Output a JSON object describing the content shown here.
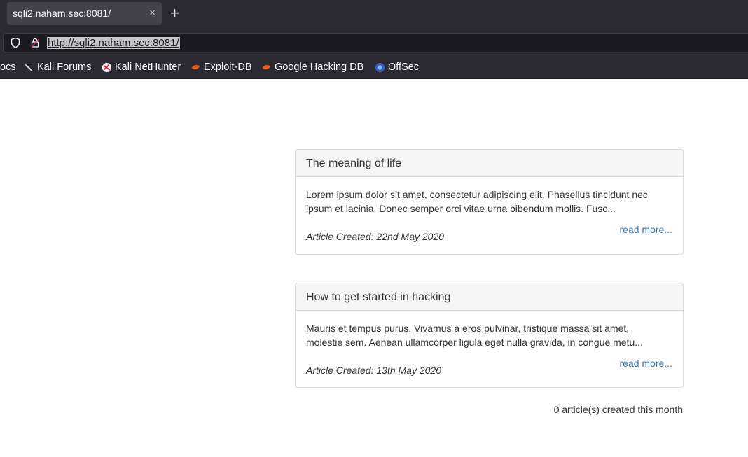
{
  "browser": {
    "tab_title": "sqli2.naham.sec:8081/",
    "tab_close": "×",
    "new_tab": "+",
    "url": "http://sqli2.naham.sec:8081/",
    "bookmarks": [
      {
        "label": "ocs",
        "icon": "none"
      },
      {
        "label": "Kali Forums",
        "icon": "kali-dragon-icon"
      },
      {
        "label": "Kali NetHunter",
        "icon": "nethunter-icon"
      },
      {
        "label": "Exploit-DB",
        "icon": "exploit-db-icon"
      },
      {
        "label": "Google Hacking DB",
        "icon": "ghdb-icon"
      },
      {
        "label": "OffSec",
        "icon": "offsec-icon"
      }
    ]
  },
  "articles": [
    {
      "title": "The meaning of life",
      "excerpt": "Lorem ipsum dolor sit amet, consectetur adipiscing elit. Phasellus tincidunt nec ipsum et lacinia. Donec semper orci vitae urna bibendum mollis. Fusc...",
      "read_more": "read more...",
      "created": "Article Created: 22nd May 2020"
    },
    {
      "title": "How to get started in hacking",
      "excerpt": "Mauris et tempus purus. Vivamus a eros pulvinar, tristique massa sit amet, molestie sem. Aenean ullamcorper ligula eget nulla gravida, in congue metu...",
      "read_more": "read more...",
      "created": "Article Created: 13th May 2020"
    }
  ],
  "footer": {
    "count_text": "0 article(s) created this month"
  },
  "colors": {
    "chrome_bg": "#2b2a33",
    "link": "#337ab7",
    "panel_heading_bg": "#f5f5f5"
  }
}
